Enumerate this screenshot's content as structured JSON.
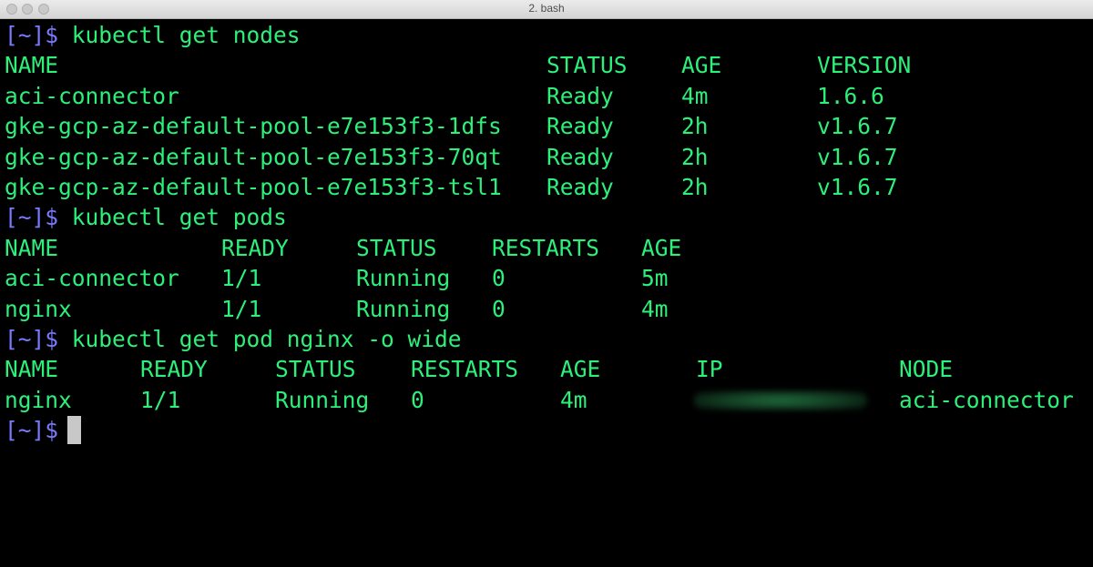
{
  "window": {
    "title": "2. bash"
  },
  "prompt": "[~]$",
  "commands": {
    "get_nodes": "kubectl get nodes",
    "get_pods": "kubectl get pods",
    "get_pod_wide": "kubectl get pod nginx -o wide"
  },
  "nodes": {
    "headers": [
      "NAME",
      "STATUS",
      "AGE",
      "VERSION"
    ],
    "rows": [
      [
        "aci-connector",
        "Ready",
        "4m",
        "1.6.6"
      ],
      [
        "gke-gcp-az-default-pool-e7e153f3-1dfs",
        "Ready",
        "2h",
        "v1.6.7"
      ],
      [
        "gke-gcp-az-default-pool-e7e153f3-70qt",
        "Ready",
        "2h",
        "v1.6.7"
      ],
      [
        "gke-gcp-az-default-pool-e7e153f3-tsl1",
        "Ready",
        "2h",
        "v1.6.7"
      ]
    ]
  },
  "pods": {
    "headers": [
      "NAME",
      "READY",
      "STATUS",
      "RESTARTS",
      "AGE"
    ],
    "rows": [
      [
        "aci-connector",
        "1/1",
        "Running",
        "0",
        "5m"
      ],
      [
        "nginx",
        "1/1",
        "Running",
        "0",
        "4m"
      ]
    ]
  },
  "pod_wide": {
    "headers": [
      "NAME",
      "READY",
      "STATUS",
      "RESTARTS",
      "AGE",
      "IP",
      "NODE"
    ],
    "rows": [
      [
        "nginx",
        "1/1",
        "Running",
        "0",
        "4m",
        "",
        "aci-connector"
      ]
    ]
  },
  "colors": {
    "background": "#000000",
    "text": "#2cf079",
    "prompt": "#7a7aff",
    "cursor": "#c8c8c8"
  }
}
